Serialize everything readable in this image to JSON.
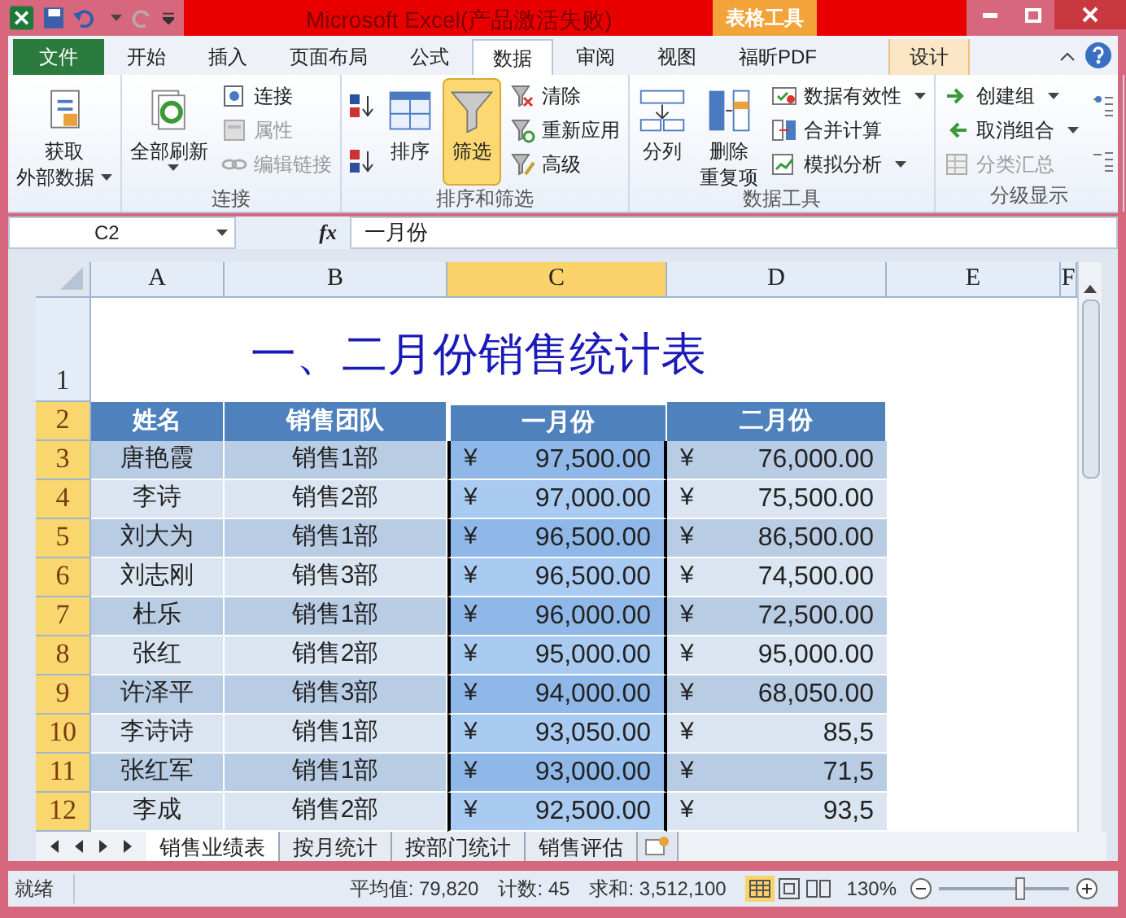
{
  "window": {
    "title": "Microsoft Excel(产品激活失败)",
    "context_tab": "表格工具"
  },
  "ribbon_tabs": [
    {
      "label": "文件",
      "kind": "file",
      "selected": false
    },
    {
      "label": "开始",
      "kind": "normal",
      "selected": false
    },
    {
      "label": "插入",
      "kind": "normal",
      "selected": false
    },
    {
      "label": "页面布局",
      "kind": "normal",
      "selected": false
    },
    {
      "label": "公式",
      "kind": "normal",
      "selected": false
    },
    {
      "label": "数据",
      "kind": "normal",
      "selected": true
    },
    {
      "label": "审阅",
      "kind": "normal",
      "selected": false
    },
    {
      "label": "视图",
      "kind": "normal",
      "selected": false
    },
    {
      "label": "福昕PDF",
      "kind": "normal",
      "selected": false
    },
    {
      "label": "设计",
      "kind": "context",
      "selected": false
    }
  ],
  "ribbon_groups": [
    {
      "items": [
        {
          "lines": [
            "获取",
            "外部数据"
          ],
          "kind": "large",
          "dropdown": true,
          "disabled": false,
          "selected": false
        }
      ]
    },
    {
      "label": "连接",
      "items": [
        {
          "lines": [
            "全部刷新"
          ],
          "kind": "large",
          "dropdown": true,
          "disabled": false,
          "selected": false
        },
        {
          "label": "连接",
          "kind": "small",
          "dropdown": false,
          "disabled": false,
          "selected": false
        },
        {
          "label": "属性",
          "kind": "small",
          "dropdown": false,
          "disabled": true,
          "selected": false
        },
        {
          "label": "编辑链接",
          "kind": "small",
          "dropdown": false,
          "disabled": true,
          "selected": false
        }
      ]
    },
    {
      "label": "排序和筛选",
      "items": [
        {
          "kind": "icon",
          "disabled": false,
          "selected": false
        },
        {
          "kind": "icon",
          "disabled": false,
          "selected": false
        },
        {
          "lines": [
            "排序"
          ],
          "kind": "large",
          "dropdown": false,
          "disabled": false,
          "selected": false
        },
        {
          "lines": [
            "筛选"
          ],
          "kind": "large",
          "dropdown": false,
          "disabled": false,
          "selected": true
        },
        {
          "label": "清除",
          "kind": "small",
          "dropdown": false,
          "disabled": false,
          "selected": false
        },
        {
          "label": "重新应用",
          "kind": "small",
          "dropdown": false,
          "disabled": false,
          "selected": false
        },
        {
          "label": "高级",
          "kind": "small",
          "dropdown": false,
          "disabled": false,
          "selected": false
        }
      ]
    },
    {
      "label": "数据工具",
      "items": [
        {
          "lines": [
            "分列"
          ],
          "kind": "large",
          "dropdown": false,
          "disabled": false,
          "selected": false
        },
        {
          "lines": [
            "删除",
            "重复项"
          ],
          "kind": "large",
          "dropdown": false,
          "disabled": false,
          "selected": false
        },
        {
          "label": "数据有效性",
          "kind": "small",
          "dropdown": true,
          "disabled": false,
          "selected": false
        },
        {
          "label": "合并计算",
          "kind": "small",
          "dropdown": false,
          "disabled": false,
          "selected": false
        },
        {
          "label": "模拟分析",
          "kind": "small",
          "dropdown": true,
          "disabled": false,
          "selected": false
        }
      ]
    },
    {
      "label": "分级显示",
      "items": [
        {
          "label": "创建组",
          "kind": "small",
          "dropdown": true,
          "disabled": false,
          "selected": false
        },
        {
          "label": "取消组合",
          "kind": "small",
          "dropdown": true,
          "disabled": false,
          "selected": false
        },
        {
          "label": "分类汇总",
          "kind": "small",
          "dropdown": false,
          "disabled": true,
          "selected": false
        },
        {
          "kind": "icon",
          "disabled": false,
          "selected": false
        },
        {
          "kind": "icon",
          "disabled": false,
          "selected": false
        }
      ]
    }
  ],
  "formula_bar": {
    "name_box": "C2",
    "function_label": "fx",
    "formula": "一月份"
  },
  "sheet": {
    "columns": [
      {
        "label": "A",
        "selected": false
      },
      {
        "label": "B",
        "selected": false
      },
      {
        "label": "C",
        "selected": true
      },
      {
        "label": "D",
        "selected": false
      },
      {
        "label": "E",
        "selected": false
      },
      {
        "label": "F",
        "selected": false
      }
    ],
    "title_row": {
      "number": "1",
      "selected": false,
      "text": "一、二月份销售统计表"
    },
    "header_row": {
      "number": "2",
      "selected": true,
      "cells": [
        "姓名",
        "销售团队",
        "一月份",
        "二月份"
      ]
    },
    "rows": [
      {
        "number": "3",
        "selected": true,
        "name": "唐艳霞",
        "team": "销售1部",
        "jan": {
          "symbol": "¥",
          "amount": "97,500.00"
        },
        "feb": {
          "symbol": "¥",
          "amount": "76,000.00"
        }
      },
      {
        "number": "4",
        "selected": true,
        "name": "李诗",
        "team": "销售2部",
        "jan": {
          "symbol": "¥",
          "amount": "97,000.00"
        },
        "feb": {
          "symbol": "¥",
          "amount": "75,500.00"
        }
      },
      {
        "number": "5",
        "selected": true,
        "name": "刘大为",
        "team": "销售1部",
        "jan": {
          "symbol": "¥",
          "amount": "96,500.00"
        },
        "feb": {
          "symbol": "¥",
          "amount": "86,500.00"
        }
      },
      {
        "number": "6",
        "selected": true,
        "name": "刘志刚",
        "team": "销售3部",
        "jan": {
          "symbol": "¥",
          "amount": "96,500.00"
        },
        "feb": {
          "symbol": "¥",
          "amount": "74,500.00"
        }
      },
      {
        "number": "7",
        "selected": true,
        "name": "杜乐",
        "team": "销售1部",
        "jan": {
          "symbol": "¥",
          "amount": "96,000.00"
        },
        "feb": {
          "symbol": "¥",
          "amount": "72,500.00"
        }
      },
      {
        "number": "8",
        "selected": true,
        "name": "张红",
        "team": "销售2部",
        "jan": {
          "symbol": "¥",
          "amount": "95,000.00"
        },
        "feb": {
          "symbol": "¥",
          "amount": "95,000.00"
        }
      },
      {
        "number": "9",
        "selected": true,
        "name": "许泽平",
        "team": "销售3部",
        "jan": {
          "symbol": "¥",
          "amount": "94,000.00"
        },
        "feb": {
          "symbol": "¥",
          "amount": "68,050.00"
        }
      },
      {
        "number": "10",
        "selected": true,
        "name": "李诗诗",
        "team": "销售1部",
        "jan": {
          "symbol": "¥",
          "amount": "93,050.00"
        },
        "feb": {
          "symbol": "¥",
          "amount": "85,5"
        }
      },
      {
        "number": "11",
        "selected": true,
        "name": "张红军",
        "team": "销售1部",
        "jan": {
          "symbol": "¥",
          "amount": "93,000.00"
        },
        "feb": {
          "symbol": "¥",
          "amount": "71,5"
        }
      },
      {
        "number": "12",
        "selected": true,
        "name": "李成",
        "team": "销售2部",
        "jan": {
          "symbol": "¥",
          "amount": "92,500.00"
        },
        "feb": {
          "symbol": "¥",
          "amount": "93,5"
        }
      }
    ]
  },
  "sheet_tabs": [
    {
      "label": "销售业绩表",
      "selected": true
    },
    {
      "label": "按月统计",
      "selected": false
    },
    {
      "label": "按部门统计",
      "selected": false
    },
    {
      "label": "销售评估",
      "selected": false
    }
  ],
  "status_bar": {
    "mode": "就绪",
    "average": "平均值: 79,820",
    "count": "计数: 45",
    "sum": "求和: 3,512,100",
    "zoom": "130%",
    "zoom_slider": {
      "level": 0.62
    }
  }
}
